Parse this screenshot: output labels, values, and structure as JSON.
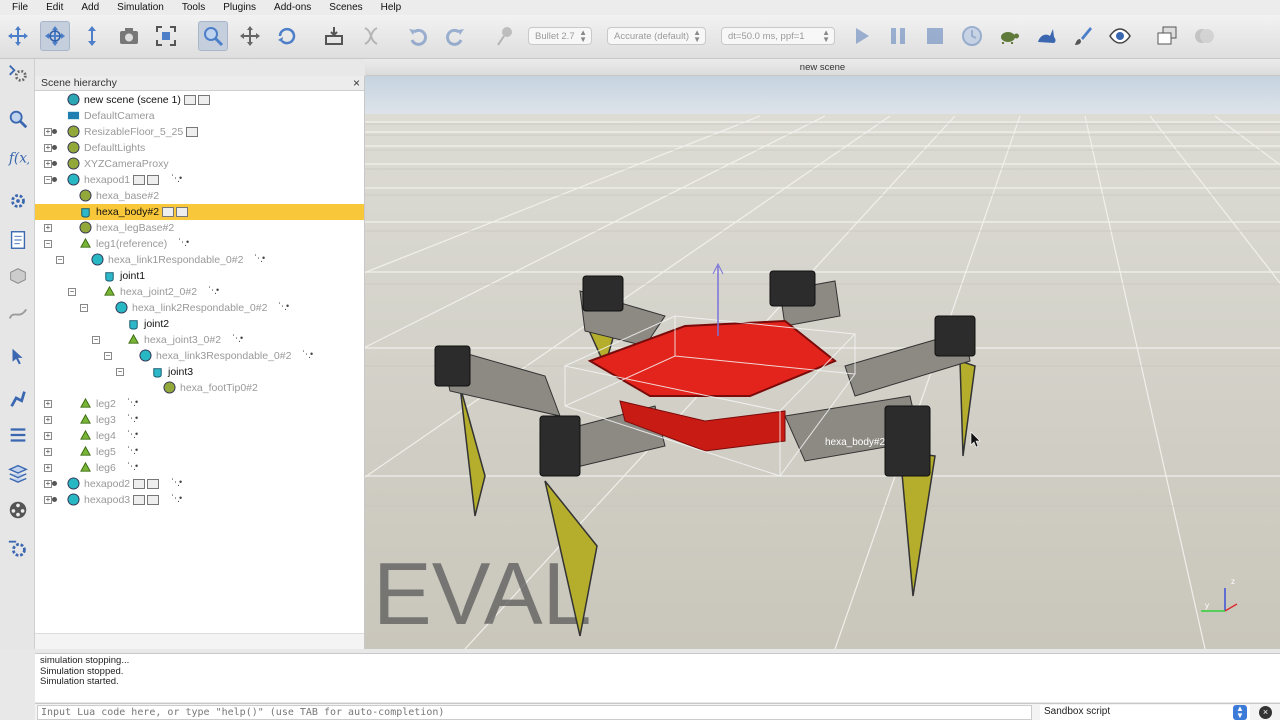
{
  "menu": [
    "File",
    "Edit",
    "Add",
    "Simulation",
    "Tools",
    "Plugins",
    "Add-ons",
    "Scenes",
    "Help"
  ],
  "toolbar": {
    "engine": "Bullet 2.7",
    "accuracy": "Accurate (default)",
    "timestep": "dt=50.0 ms, ppf=1"
  },
  "view": {
    "title": "new scene",
    "watermark": "EVAL",
    "object_label": "hexa_body#2",
    "axis_y": "y",
    "axis_z": "z"
  },
  "hierarchy": {
    "title": "Scene hierarchy",
    "close": "×",
    "items": [
      {
        "label": "new scene (scene 1)",
        "dark": true
      },
      {
        "label": "DefaultCamera"
      },
      {
        "label": "ResizableFloor_5_25"
      },
      {
        "label": "DefaultLights"
      },
      {
        "label": "XYZCameraProxy"
      },
      {
        "label": "hexapod1"
      },
      {
        "label": "hexa_base#2"
      },
      {
        "label": "hexa_body#2",
        "dark": true
      },
      {
        "label": "hexa_legBase#2"
      },
      {
        "label": "leg1(reference)"
      },
      {
        "label": "hexa_link1Respondable_0#2"
      },
      {
        "label": "joint1",
        "dark": true
      },
      {
        "label": "hexa_joint2_0#2"
      },
      {
        "label": "hexa_link2Respondable_0#2"
      },
      {
        "label": "joint2",
        "dark": true
      },
      {
        "label": "hexa_joint3_0#2"
      },
      {
        "label": "hexa_link3Respondable_0#2"
      },
      {
        "label": "joint3",
        "dark": true
      },
      {
        "label": "hexa_footTip0#2"
      },
      {
        "label": "leg2"
      },
      {
        "label": "leg3"
      },
      {
        "label": "leg4"
      },
      {
        "label": "leg5"
      },
      {
        "label": "leg6"
      },
      {
        "label": "hexapod2"
      },
      {
        "label": "hexapod3"
      }
    ]
  },
  "console": {
    "lines": [
      "simulation stopping...",
      "Simulation stopped.",
      "Simulation started."
    ]
  },
  "input": {
    "placeholder": "Input Lua code here, or type \"help()\" (use TAB for auto-completion)",
    "script": "Sandbox script",
    "arrows": "▲▼",
    "clear": "×"
  }
}
